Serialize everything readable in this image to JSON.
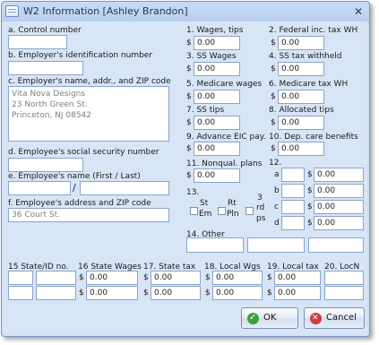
{
  "window": {
    "title": "W2 Information [Ashley Brandon]",
    "close_glyph": "✕"
  },
  "left": {
    "control_number_label": "a. Control number",
    "control_number_value": "",
    "employer_id_label": "b. Employer's identification number",
    "employer_id_value": "",
    "employer_addr_label": "c. Employer's name, addr., and ZIP code",
    "employer_addr_lines": [
      "Vita Nova Designs",
      "23 North Green St.",
      "Princeton, NJ  08542"
    ],
    "employee_ssn_label": "d. Employee's social security number",
    "employee_ssn_value": "",
    "employee_name_label": "e. Employee's name (First / Last)",
    "employee_first": "",
    "employee_last": "",
    "name_separator": "/",
    "employee_addr_label": "f. Employee's address and ZIP code",
    "employee_addr_value": "36 Court St."
  },
  "boxes_mid": [
    {
      "label": "1. Wages, tips",
      "value": "0.00"
    },
    {
      "label": "3. SS Wages",
      "value": "0.00"
    },
    {
      "label": "5. Medicare wages",
      "value": "0.00"
    },
    {
      "label": "7. SS tips",
      "value": "0.00"
    },
    {
      "label": "9. Advance EIC pay.",
      "value": "0.00"
    },
    {
      "label": "11. Nonqual. plans",
      "value": "0.00"
    }
  ],
  "boxes_right": [
    {
      "label": "2. Federal inc. tax WH",
      "value": "0.00"
    },
    {
      "label": "4. SS tax withheld",
      "value": "0.00"
    },
    {
      "label": "6. Medicare tax WH",
      "value": "0.00"
    },
    {
      "label": "8. Allocated tips",
      "value": "0.00"
    },
    {
      "label": "10. Dep. care benefits",
      "value": "0.00"
    }
  ],
  "box12": {
    "label": "12.",
    "rows": [
      {
        "letter": "a",
        "code": "",
        "value": "0.00"
      },
      {
        "letter": "b",
        "code": "",
        "value": "0.00"
      },
      {
        "letter": "c",
        "code": "",
        "value": "0.00"
      },
      {
        "letter": "d",
        "code": "",
        "value": "0.00"
      }
    ]
  },
  "box13": {
    "label": "13.",
    "statutory_top": "St",
    "statutory_bottom": "Em",
    "retirement_top": "Rt",
    "retirement_bottom": "Pln",
    "thirdparty_top": "3",
    "thirdparty_mid": "rd",
    "thirdparty_bottom": "ps"
  },
  "box14": {
    "label": "14. Other",
    "values": [
      "",
      "",
      ""
    ]
  },
  "bottom": {
    "state_label": "15 State/ID no.",
    "state_wages_label": "16 State Wages",
    "state_tax_label": "17. State tax",
    "local_wages_label": "18. Local Wgs",
    "local_tax_label": "19. Local tax",
    "locality_label": "20. LocN",
    "rows": [
      {
        "state": "",
        "id": "",
        "state_wages": "0.00",
        "state_tax": "0.00",
        "local_wages": "0.00",
        "local_tax": "0.00",
        "locality": ""
      },
      {
        "state": "",
        "id": "",
        "state_wages": "0.00",
        "state_tax": "0.00",
        "local_wages": "0.00",
        "local_tax": "0.00",
        "locality": ""
      }
    ]
  },
  "currency": "$",
  "buttons": {
    "ok": "OK",
    "cancel": "Cancel"
  }
}
